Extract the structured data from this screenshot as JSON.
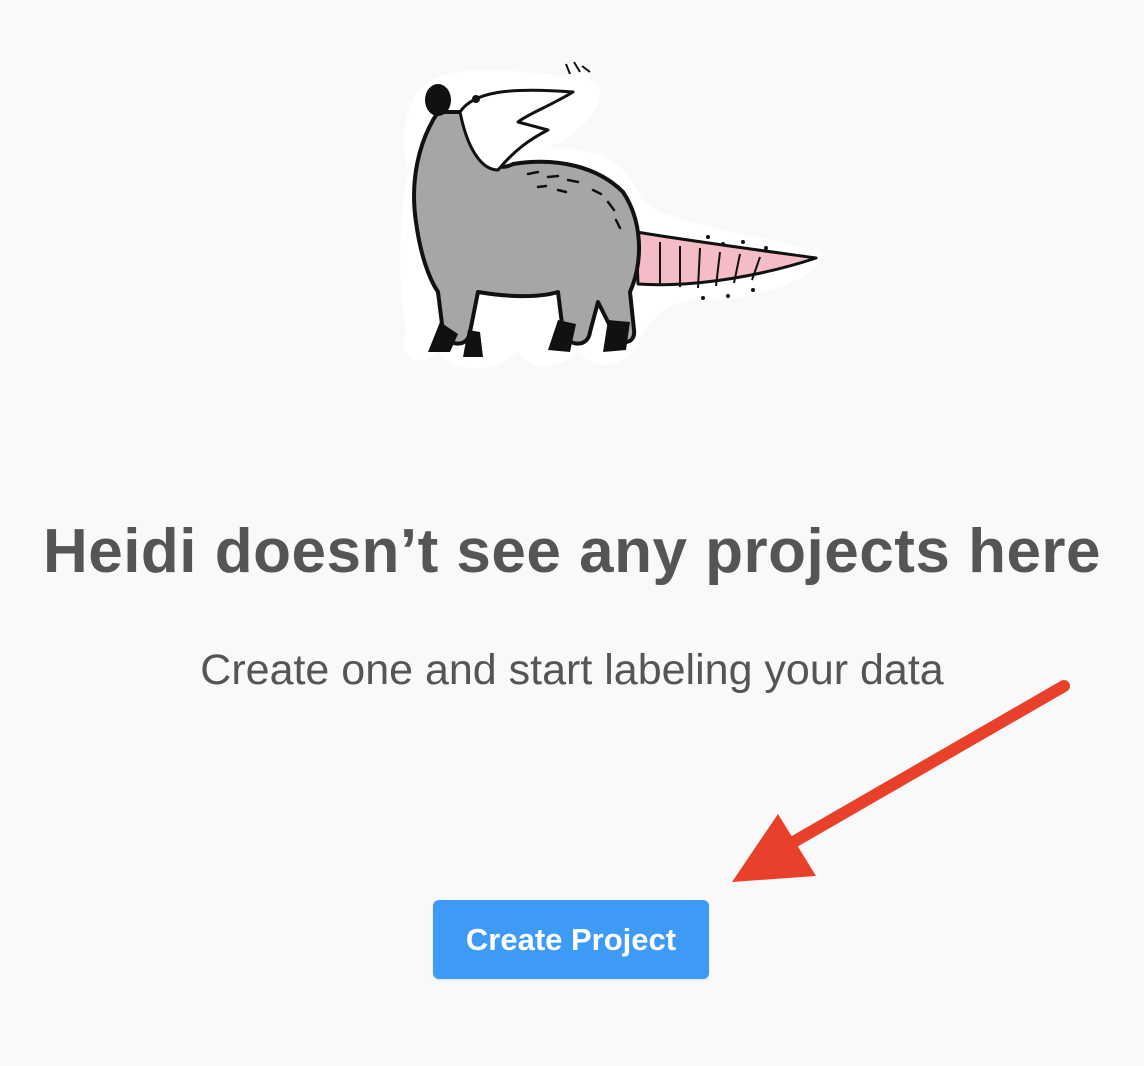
{
  "empty_state": {
    "illustration": "opossum-illustration",
    "heading": "Heidi doesn’t see any projects here",
    "subheading": "Create one and start labeling your data",
    "create_button_label": "Create Project"
  },
  "annotation": {
    "icon": "red-arrow-icon",
    "color": "#e8402a"
  },
  "colors": {
    "background": "#f9f9f9",
    "button": "#3d9bf5",
    "text": "#555555"
  }
}
